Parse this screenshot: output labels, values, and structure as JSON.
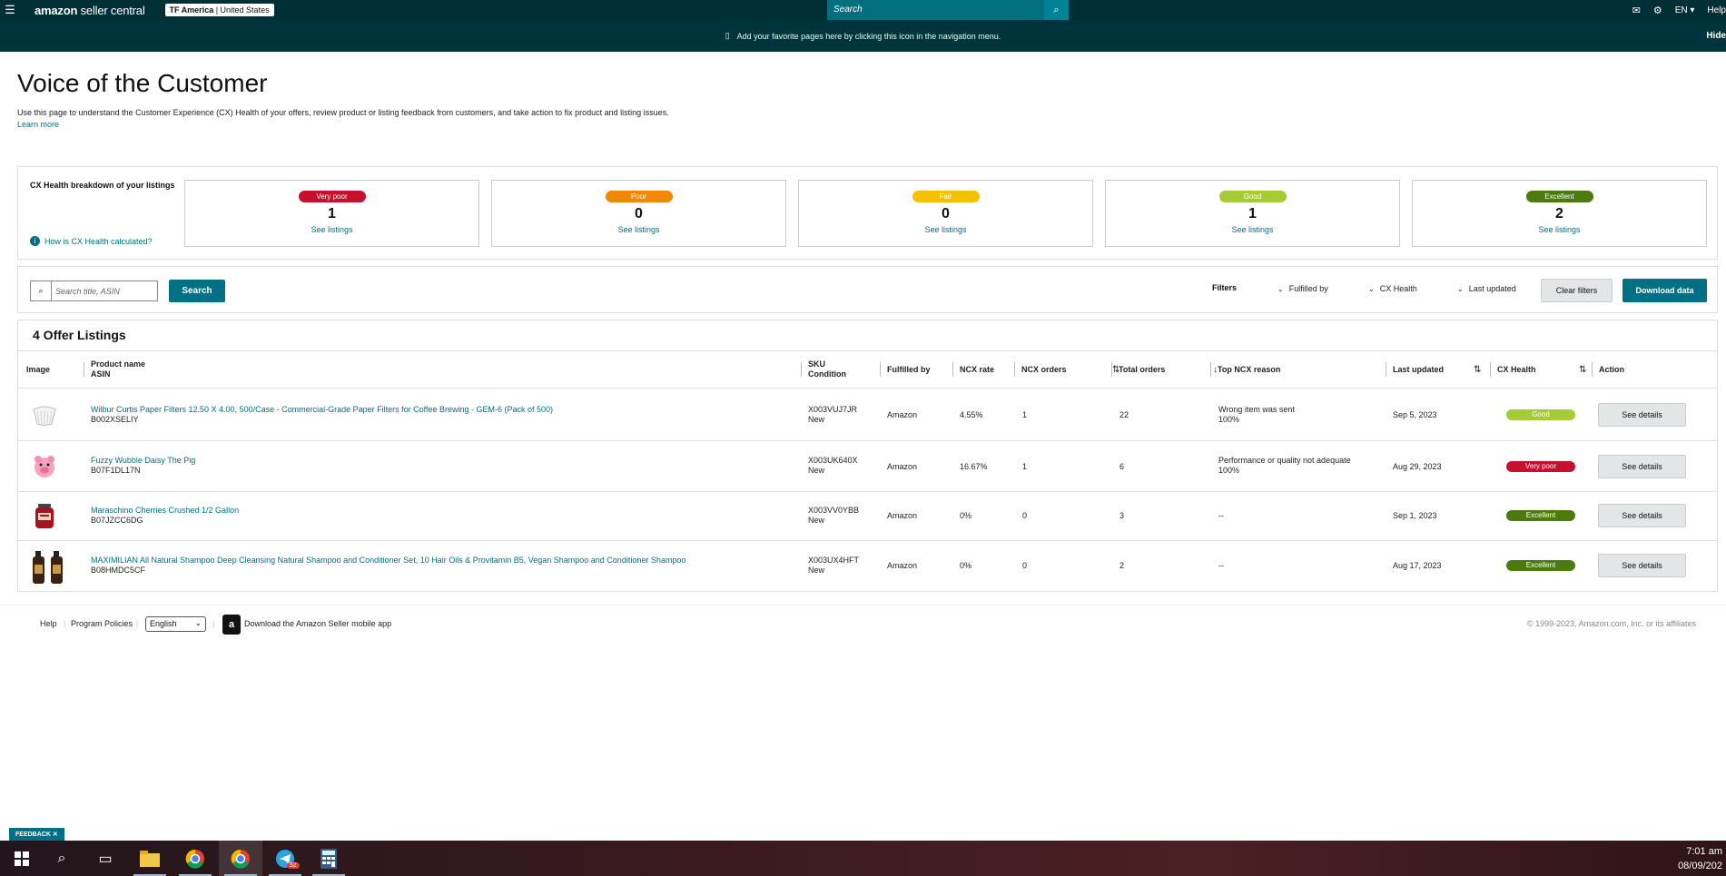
{
  "topbar": {
    "logo_main": "amazon",
    "logo_sub": " seller central",
    "account_name": "TF America",
    "account_region": " | United States",
    "search_placeholder": "Search",
    "lang": "EN",
    "help": "Help"
  },
  "favbar": {
    "text": "Add your favorite pages here by clicking this icon in the navigation menu.",
    "hide": "Hide"
  },
  "page": {
    "title": "Voice of the Customer",
    "description": "Use this page to understand the Customer Experience (CX) Health of your offers, review product or listing feedback from customers, and take action to fix product and listing issues.",
    "learn_more": "Learn more"
  },
  "health": {
    "label": "CX Health breakdown of your listings",
    "how": "How is CX Health calculated?",
    "cards": [
      {
        "label": "Very poor",
        "count": "1",
        "link": "See listings",
        "color": "#c7102e"
      },
      {
        "label": "Poor",
        "count": "0",
        "link": "See listings",
        "color": "#f08804"
      },
      {
        "label": "Fair",
        "count": "0",
        "link": "See listings",
        "color": "#f5c000"
      },
      {
        "label": "Good",
        "count": "1",
        "link": "See listings",
        "color": "#a6cc33"
      },
      {
        "label": "Excellent",
        "count": "2",
        "link": "See listings",
        "color": "#4b7a0f"
      }
    ]
  },
  "searchbar": {
    "placeholder": "Search title, ASIN",
    "search_btn": "Search",
    "filters_label": "Filters",
    "filter_fulfilled": "Fulfilled by",
    "filter_health": "CX Health",
    "filter_updated": "Last updated",
    "clear": "Clear filters",
    "download": "Download data"
  },
  "table": {
    "title": "4 Offer Listings",
    "headers": {
      "image": "Image",
      "product": "Product name",
      "asin": "ASIN",
      "sku": "SKU",
      "condition": "Condition",
      "fulfilled": "Fulfilled by",
      "ncx_rate": "NCX rate",
      "ncx_orders": "NCX orders",
      "total_orders": "Total orders",
      "top_reason": "Top NCX reason",
      "last_updated": "Last updated",
      "cx_health": "CX Health",
      "action": "Action"
    },
    "rows": [
      {
        "name": "Wilbur Curtis Paper Filters 12.50 X 4.00, 500/Case - Commercial-Grade Paper Filters for Coffee Brewing - GEM-6 (Pack of 500)",
        "asin": "B002XSELIY",
        "sku": "X003VUJ7JR",
        "condition": "New",
        "fulfilled": "Amazon",
        "ncx_rate": "4.55%",
        "ncx_orders": "1",
        "total_orders": "22",
        "reason": "Wrong item was sent",
        "reason_pct": "100%",
        "updated": "Sep 5, 2023",
        "health": "Good",
        "health_color": "#a6cc33",
        "action": "See details"
      },
      {
        "name": "Fuzzy Wubble Daisy The Pig",
        "asin": "B07F1DL17N",
        "sku": "X003UK640X",
        "condition": "New",
        "fulfilled": "Amazon",
        "ncx_rate": "16.67%",
        "ncx_orders": "1",
        "total_orders": "6",
        "reason": "Performance or quality not adequate",
        "reason_pct": "100%",
        "updated": "Aug 29, 2023",
        "health": "Very poor",
        "health_color": "#c7102e",
        "action": "See details"
      },
      {
        "name": "Maraschino Cherries Crushed 1/2 Gallon",
        "asin": "B07JZCC6DG",
        "sku": "X003VV0YBB",
        "condition": "New",
        "fulfilled": "Amazon",
        "ncx_rate": "0%",
        "ncx_orders": "0",
        "total_orders": "3",
        "reason": "--",
        "reason_pct": "",
        "updated": "Sep 1, 2023",
        "health": "Excellent",
        "health_color": "#4b7a0f",
        "action": "See details"
      },
      {
        "name": "MAXIMILIAN All Natural Shampoo Deep Cleansing Natural Shampoo and Conditioner Set, 10 Hair Oils & Provitamin B5, Vegan Shampoo and Conditioner Shampoo",
        "asin": "B08HMDC5CF",
        "sku": "X003UX4HFT",
        "condition": "New",
        "fulfilled": "Amazon",
        "ncx_rate": "0%",
        "ncx_orders": "0",
        "total_orders": "2",
        "reason": "--",
        "reason_pct": "",
        "updated": "Aug 17, 2023",
        "health": "Excellent",
        "health_color": "#4b7a0f",
        "action": "See details"
      }
    ]
  },
  "footer": {
    "help": "Help",
    "policies": "Program Policies",
    "language": "English",
    "app": "Download the Amazon Seller mobile app",
    "copyright": "© 1999-2023, Amazon.com, Inc. or its affiliates"
  },
  "feedback": "FEEDBACK ✕",
  "taskbar": {
    "time": "7:01 am",
    "date": "08/09/202",
    "telegram_badge": "52"
  }
}
